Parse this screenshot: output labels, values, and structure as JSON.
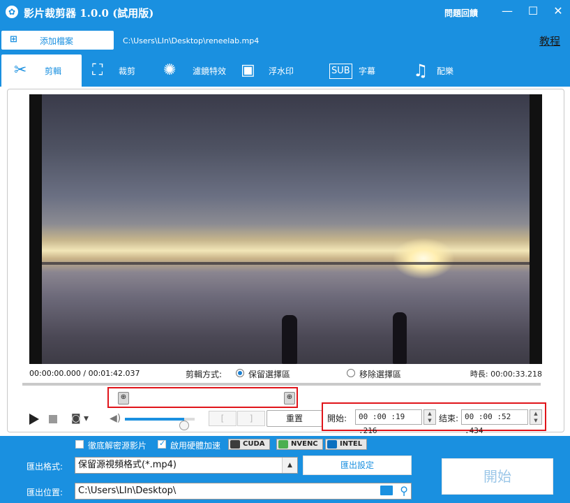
{
  "app": {
    "title": "影片裁剪器 1.0.0 (試用版)",
    "feedback": "問題回饋",
    "minimize": "—",
    "maximize": "☐",
    "close": "✕"
  },
  "filebar": {
    "add_file": "添加檔案",
    "file_path": "C:\\Users\\LIn\\Desktop\\reneelab.mp4",
    "tutorial": "教程"
  },
  "tabs": [
    {
      "label": "剪輯",
      "icon": "clip-icon",
      "active": true
    },
    {
      "label": "裁剪",
      "icon": "crop-icon"
    },
    {
      "label": "濾鏡特效",
      "icon": "filter-icon"
    },
    {
      "label": "浮水印",
      "icon": "watermark-icon"
    },
    {
      "label": "字幕",
      "icon": "subtitle-icon"
    },
    {
      "label": "配樂",
      "icon": "music-icon"
    }
  ],
  "player": {
    "position": "00:00:00.000 / 00:01:42.037",
    "mode_label": "剪輯方式:",
    "mode_keep": "保留選擇區",
    "mode_remove": "移除選擇區",
    "mode_selected": "keep",
    "duration": "時長:  00:00:33.218",
    "reset": "重置",
    "bracket_left": "[",
    "bracket_right": "]",
    "volume_level": 0.85,
    "selection": {
      "start": 0.188,
      "end": 0.514
    }
  },
  "time": {
    "start_label": "開始:",
    "start_value": "00 :00 :19 .216",
    "end_label": "结束:",
    "end_value": "00 :00 :52 .434"
  },
  "bottom": {
    "full_decrypt": "徹底解密源影片",
    "hw_accel": "啟用硬體加速",
    "hw_accel_checked": true,
    "full_decrypt_checked": false,
    "accelerators": [
      "CUDA",
      "NVENC",
      "INTEL"
    ],
    "format_label": "匯出格式:",
    "format_value": "保留源視頻格式(*.mp4)",
    "export_settings": "匯出設定",
    "location_label": "匯出位置:",
    "location_value": "C:\\Users\\LIn\\Desktop\\",
    "start": "開始"
  },
  "colors": {
    "brand": "#1a90e0",
    "highlight_box": "#e0141a"
  }
}
